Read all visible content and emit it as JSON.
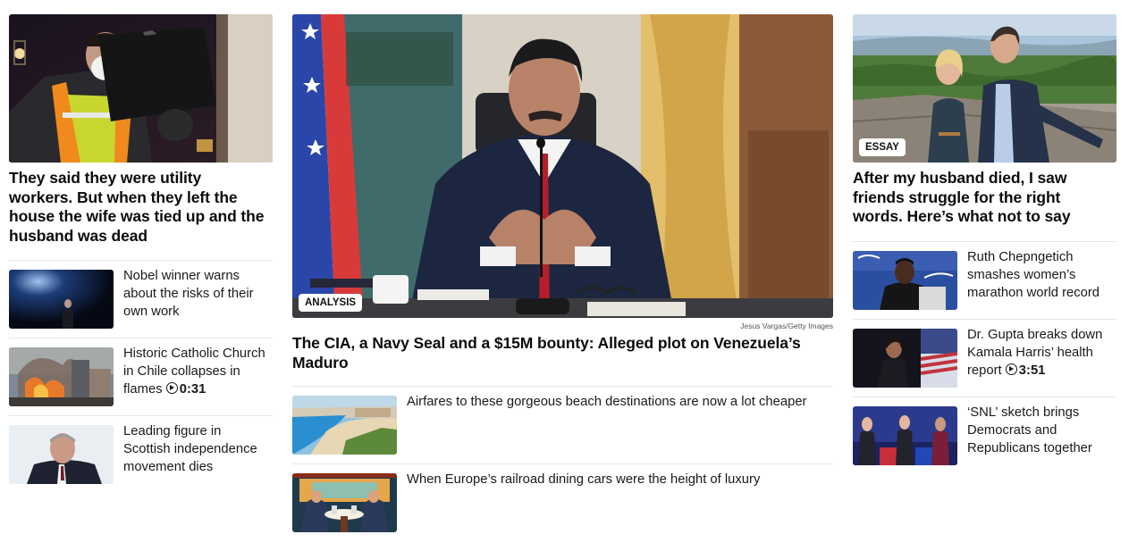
{
  "left": {
    "lead": {
      "headline": "They said they were utility workers. But when they left the house the wife was tied up and the husband was dead"
    },
    "items": [
      {
        "text": "Nobel winner warns about the risks of their own work"
      },
      {
        "text": "Historic Catholic Church in Chile collapses in flames",
        "duration": "0:31"
      },
      {
        "text": "Leading figure in Scottish independence movement dies"
      }
    ]
  },
  "middle": {
    "lead": {
      "badge": "ANALYSIS",
      "credit": "Jesus Vargas/Getty Images",
      "headline": "The CIA, a Navy Seal and a $15M bounty: Alleged plot on Venezuela’s Maduro"
    },
    "items": [
      {
        "text": "Airfares to these gorgeous beach destinations are now a lot cheaper"
      },
      {
        "text": "When Europe’s railroad dining cars were the height of luxury"
      }
    ]
  },
  "right": {
    "lead": {
      "badge": "ESSAY",
      "headline": "After my husband died, I saw friends struggle for the right words. Here’s what not to say"
    },
    "items": [
      {
        "text": "Ruth Chepngetich smashes women’s marathon world record"
      },
      {
        "text": "Dr. Gupta breaks down Kamala Harris’ health report",
        "duration": "3:51"
      },
      {
        "text": "‘SNL’ sketch brings Democrats and Republicans together"
      }
    ]
  }
}
